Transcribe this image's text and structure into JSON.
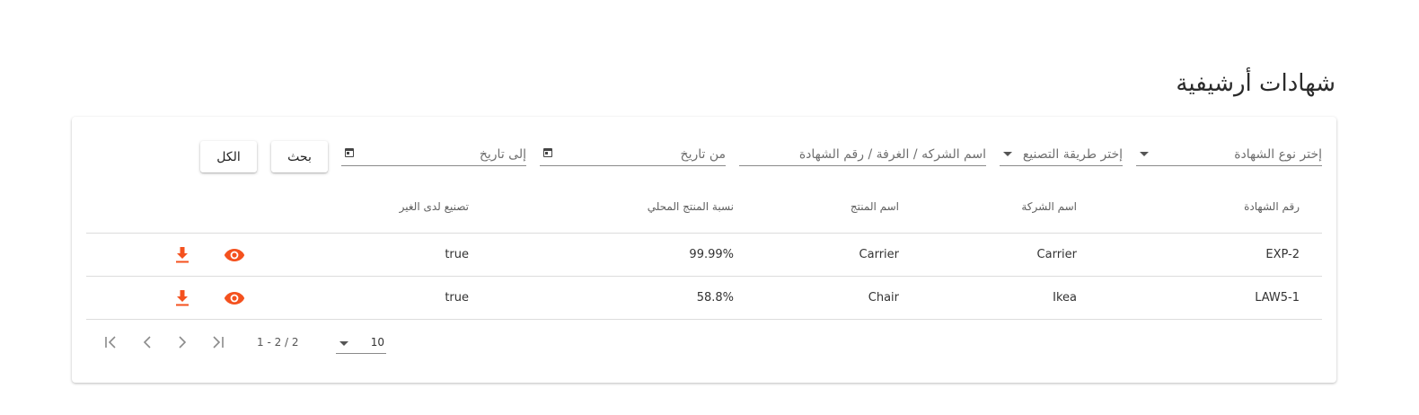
{
  "page": {
    "title": "شهادات أرشيفية"
  },
  "filters": {
    "certificate_type_placeholder": "إختر نوع الشهادة",
    "manufacturing_method_placeholder": "إختر طريقة التصنيع",
    "search_text_placeholder": "اسم الشركه / الغرفة / رقم الشهادة",
    "from_date_placeholder": "من تاريخ",
    "to_date_placeholder": "إلى تاريخ",
    "search_button": "بحث",
    "all_button": "الكل"
  },
  "table": {
    "columns": [
      "رقم الشهادة",
      "اسم الشركة",
      "اسم المنتج",
      "نسبة المنتج المحلي",
      "تصنيع لدى الغير"
    ],
    "rows": [
      {
        "certificate_number": "EXP-2",
        "company": "Carrier",
        "product": "Carrier",
        "local_ratio": "99.99%",
        "third_party": "true"
      },
      {
        "certificate_number": "LAW5-1",
        "company": "Ikea",
        "product": "Chair",
        "local_ratio": "58.8%",
        "third_party": "true"
      }
    ],
    "row_actions": [
      "eye-icon",
      "download-icon"
    ]
  },
  "paginator": {
    "page_size": "10",
    "range": "1 - 2 / 2"
  },
  "colors": {
    "accent": "#f4511e",
    "divider": "#dcdcdc"
  }
}
